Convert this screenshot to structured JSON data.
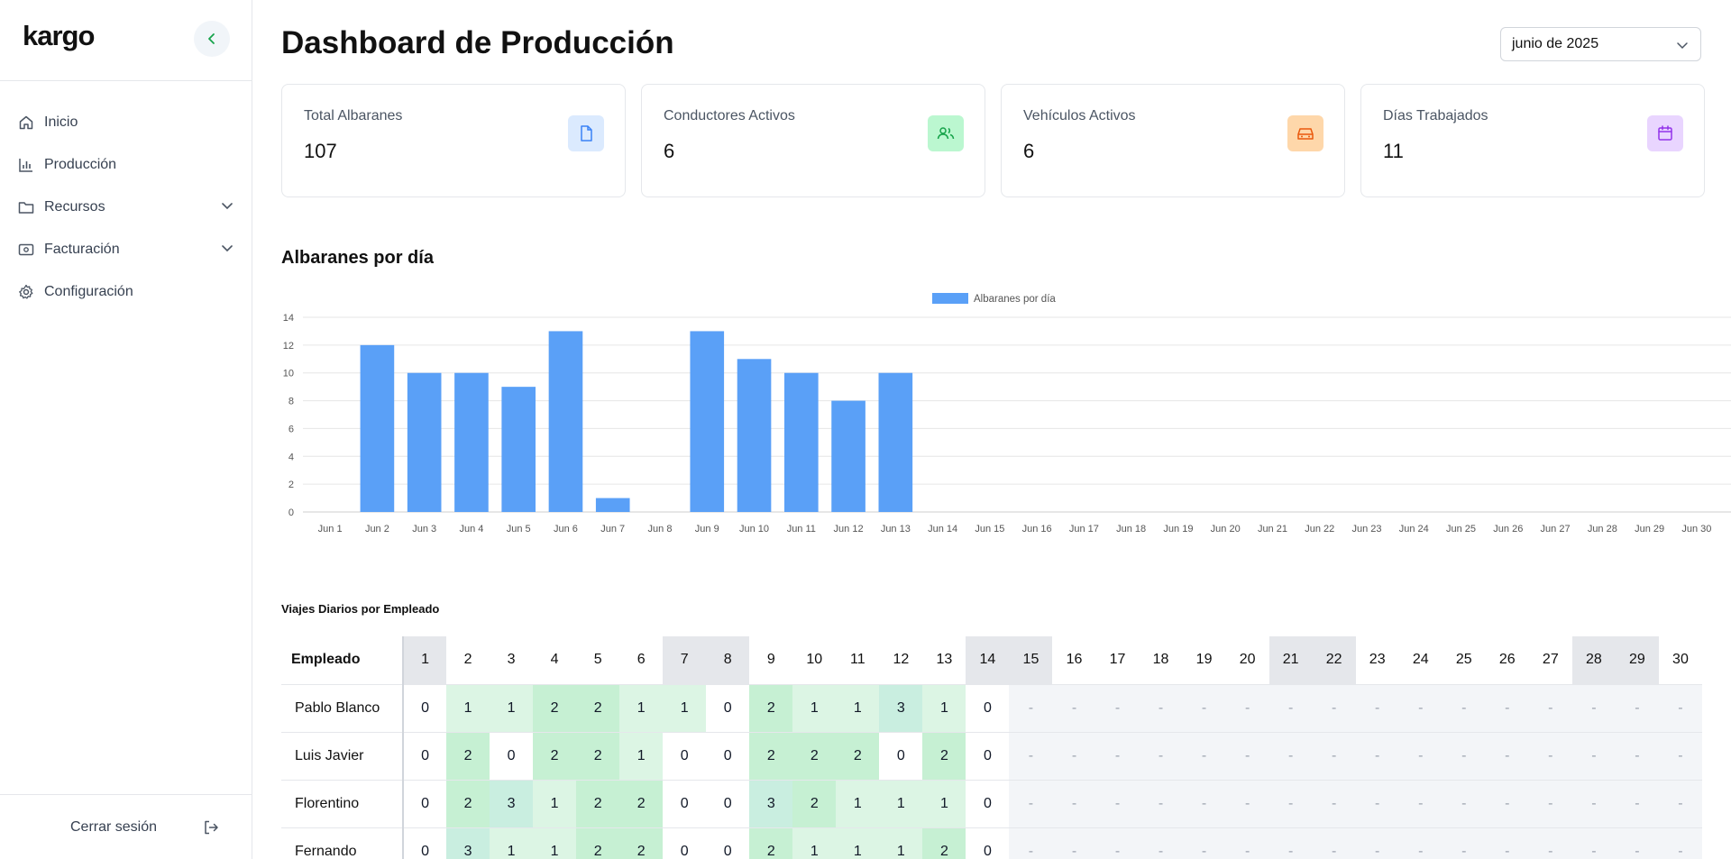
{
  "sidebar": {
    "logo": "kargo",
    "items": [
      {
        "label": "Inicio",
        "icon": "home-icon"
      },
      {
        "label": "Producción",
        "icon": "bar-chart-icon"
      },
      {
        "label": "Recursos",
        "icon": "folder-icon",
        "expandable": true
      },
      {
        "label": "Facturación",
        "icon": "billing-icon",
        "expandable": true
      },
      {
        "label": "Configuración",
        "icon": "gear-icon"
      }
    ],
    "logout_label": "Cerrar sesión"
  },
  "header": {
    "title": "Dashboard de Producción",
    "month_selected": "junio de 2025"
  },
  "cards": [
    {
      "label": "Total Albaranes",
      "value": "107",
      "icon": "document-icon",
      "color": "#3b82f6",
      "bg": "#dbeafe"
    },
    {
      "label": "Conductores Activos",
      "value": "6",
      "icon": "users-icon",
      "color": "#22c55e",
      "bg": "#bbf7d0"
    },
    {
      "label": "Vehículos Activos",
      "value": "6",
      "icon": "car-icon",
      "color": "#f97316",
      "bg": "#fed7aa"
    },
    {
      "label": "Días Trabajados",
      "value": "11",
      "icon": "calendar-icon",
      "color": "#a855f7",
      "bg": "#e9d5ff"
    }
  ],
  "chart_section_title": "Albaranes por día",
  "chart_data": {
    "type": "bar",
    "categories": [
      "Jun 1",
      "Jun 2",
      "Jun 3",
      "Jun 4",
      "Jun 5",
      "Jun 6",
      "Jun 7",
      "Jun 8",
      "Jun 9",
      "Jun 10",
      "Jun 11",
      "Jun 12",
      "Jun 13",
      "Jun 14",
      "Jun 15",
      "Jun 16",
      "Jun 17",
      "Jun 18",
      "Jun 19",
      "Jun 20",
      "Jun 21",
      "Jun 22",
      "Jun 23",
      "Jun 24",
      "Jun 25",
      "Jun 26",
      "Jun 27",
      "Jun 28",
      "Jun 29",
      "Jun 30"
    ],
    "series": [
      {
        "name": "Albaranes por día",
        "values": [
          0,
          12,
          10,
          10,
          9,
          13,
          1,
          0,
          13,
          11,
          10,
          8,
          10,
          0,
          0,
          0,
          0,
          0,
          0,
          0,
          0,
          0,
          0,
          0,
          0,
          0,
          0,
          0,
          0,
          0
        ]
      }
    ],
    "ylim": [
      0,
      14
    ],
    "yticks": [
      0,
      2,
      4,
      6,
      8,
      10,
      12,
      14
    ],
    "legend": "top-center",
    "grid": true,
    "color": "#5aa0f7"
  },
  "table": {
    "title": "Viajes Diarios por Empleado",
    "header_label": "Empleado",
    "days": [
      "1",
      "2",
      "3",
      "4",
      "5",
      "6",
      "7",
      "8",
      "9",
      "10",
      "11",
      "12",
      "13",
      "14",
      "15",
      "16",
      "17",
      "18",
      "19",
      "20",
      "21",
      "22",
      "23",
      "24",
      "25",
      "26",
      "27",
      "28",
      "29",
      "30"
    ],
    "weekend_days": [
      "1",
      "7",
      "8",
      "14",
      "15",
      "21",
      "22",
      "28",
      "29"
    ],
    "rows": [
      {
        "name": "Pablo Blanco",
        "values": [
          "0",
          "1",
          "1",
          "2",
          "2",
          "1",
          "1",
          "0",
          "2",
          "1",
          "1",
          "3",
          "1",
          "0",
          "-",
          "-",
          "-",
          "-",
          "-",
          "-",
          "-",
          "-",
          "-",
          "-",
          "-",
          "-",
          "-",
          "-",
          "-",
          "-"
        ]
      },
      {
        "name": "Luis Javier",
        "values": [
          "0",
          "2",
          "0",
          "2",
          "2",
          "1",
          "0",
          "0",
          "2",
          "2",
          "2",
          "0",
          "2",
          "0",
          "-",
          "-",
          "-",
          "-",
          "-",
          "-",
          "-",
          "-",
          "-",
          "-",
          "-",
          "-",
          "-",
          "-",
          "-",
          "-"
        ]
      },
      {
        "name": "Florentino",
        "values": [
          "0",
          "2",
          "3",
          "1",
          "2",
          "2",
          "0",
          "0",
          "3",
          "2",
          "1",
          "1",
          "1",
          "0",
          "-",
          "-",
          "-",
          "-",
          "-",
          "-",
          "-",
          "-",
          "-",
          "-",
          "-",
          "-",
          "-",
          "-",
          "-",
          "-"
        ]
      },
      {
        "name": "Fernando",
        "values": [
          "0",
          "3",
          "1",
          "1",
          "2",
          "2",
          "0",
          "0",
          "2",
          "1",
          "1",
          "1",
          "2",
          "0",
          "-",
          "-",
          "-",
          "-",
          "-",
          "-",
          "-",
          "-",
          "-",
          "-",
          "-",
          "-",
          "-",
          "-",
          "-",
          "-"
        ]
      }
    ]
  }
}
